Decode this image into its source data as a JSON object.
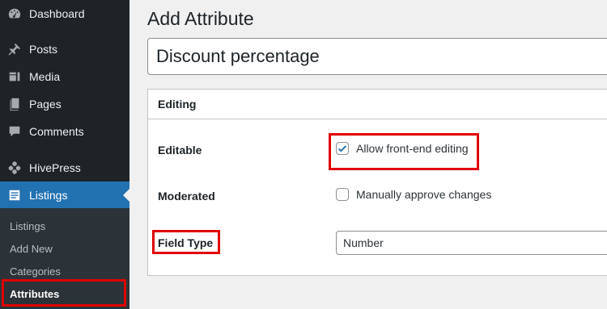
{
  "sidebar": {
    "items": [
      {
        "label": "Dashboard",
        "icon": "dashboard-icon"
      },
      {
        "label": "Posts",
        "icon": "pin-icon"
      },
      {
        "label": "Media",
        "icon": "media-icon"
      },
      {
        "label": "Pages",
        "icon": "pages-icon"
      },
      {
        "label": "Comments",
        "icon": "comment-icon"
      },
      {
        "label": "HivePress",
        "icon": "hivepress-icon"
      },
      {
        "label": "Listings",
        "icon": "listings-icon"
      }
    ],
    "current": "Listings",
    "submenu": [
      "Listings",
      "Add New",
      "Categories",
      "Attributes"
    ],
    "submenu_active": "Attributes"
  },
  "page": {
    "title": "Add Attribute",
    "name_value": "Discount percentage"
  },
  "editing": {
    "header": "Editing",
    "editable_label": "Editable",
    "editable_option": "Allow front-end editing",
    "editable_checked": true,
    "moderated_label": "Moderated",
    "moderated_option": "Manually approve changes",
    "moderated_checked": false,
    "field_type_label": "Field Type",
    "field_type_value": "Number"
  },
  "colors": {
    "sidebar_bg": "#1d2327",
    "submenu_bg": "#2c3338",
    "accent": "#2271b1",
    "highlight": "#e00000"
  }
}
